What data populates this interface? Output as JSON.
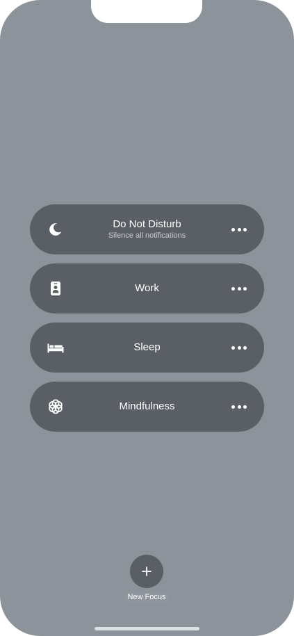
{
  "focus_modes": [
    {
      "label": "Do Not Disturb",
      "subtitle": "Silence all notifications",
      "icon": "moon-icon"
    },
    {
      "label": "Work",
      "subtitle": "",
      "icon": "id-badge-icon"
    },
    {
      "label": "Sleep",
      "subtitle": "",
      "icon": "bed-icon"
    },
    {
      "label": "Mindfulness",
      "subtitle": "",
      "icon": "mindfulness-flower-icon"
    }
  ],
  "new_focus": {
    "label": "New Focus",
    "icon": "plus-icon"
  },
  "colors": {
    "background": "#8c939b",
    "card": "#5a5f66",
    "text": "#ffffff",
    "subtitle": "#c9cdd2"
  }
}
